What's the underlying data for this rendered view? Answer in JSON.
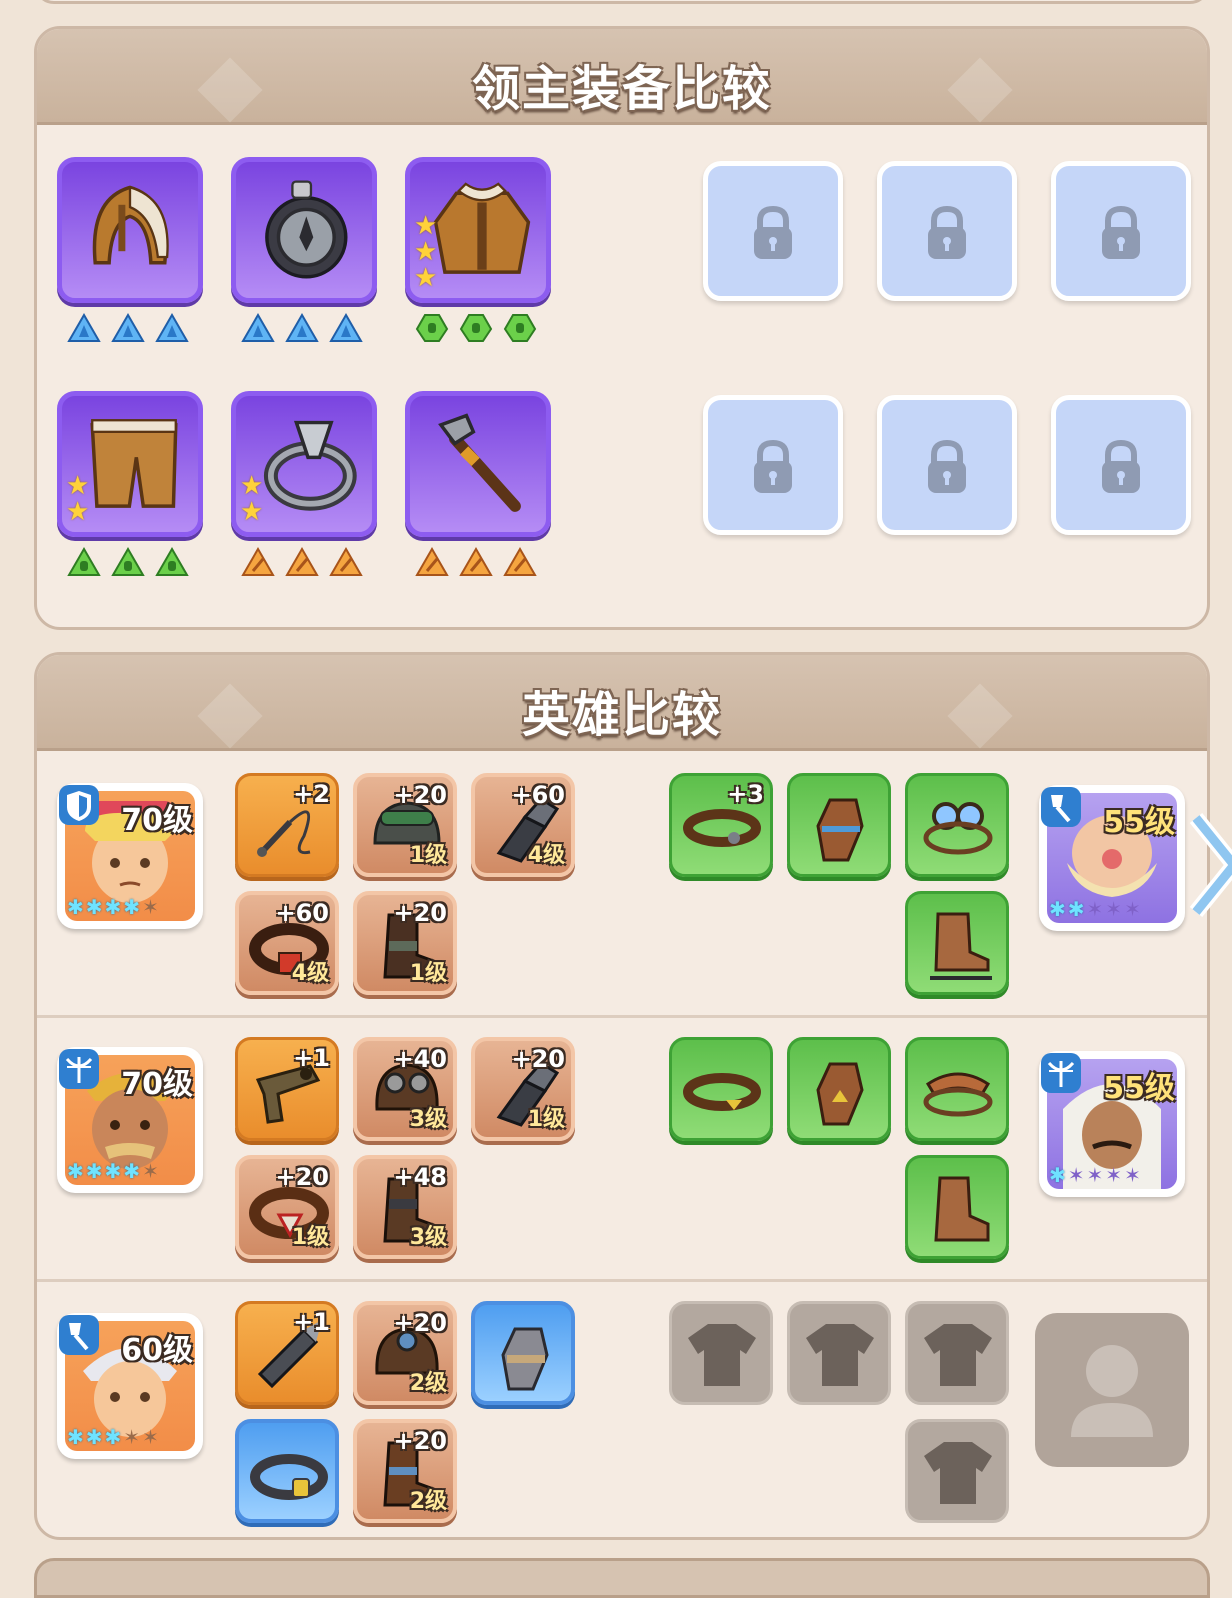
{
  "lord_section": {
    "title": "领主装备比较",
    "items": [
      {
        "name": "fur-hat-icon",
        "gems": "blue",
        "stars": 0
      },
      {
        "name": "compass-wheel-icon",
        "gems": "blue",
        "stars": 0
      },
      {
        "name": "fur-coat-icon",
        "gems": "green",
        "stars": 3
      },
      {
        "name": "fur-pants-icon",
        "gems": "green",
        "stars": 2
      },
      {
        "name": "ring-icon",
        "gems": "orange",
        "stars": 2
      },
      {
        "name": "hammer-staff-icon",
        "gems": "orange",
        "stars": 0
      }
    ],
    "locked_slots": 6
  },
  "hero_section": {
    "title": "英雄比较",
    "rows": [
      {
        "left": {
          "level": "70级",
          "class_icon": "shield-icon",
          "stars_on": 4,
          "stars_total": 5
        },
        "left_equip": [
          {
            "plus": "+2",
            "level": "",
            "tier": "gold",
            "icon": "whip-icon"
          },
          {
            "plus": "+20",
            "level": "1级",
            "tier": "bronze",
            "icon": "goggles-helmet-icon"
          },
          {
            "plus": "+60",
            "level": "4级",
            "tier": "bronze",
            "icon": "gauntlet-icon"
          },
          {
            "plus": "+60",
            "level": "4级",
            "tier": "bronze",
            "icon": "belt-icon"
          },
          {
            "plus": "+20",
            "level": "1级",
            "tier": "bronze",
            "icon": "boot-icon"
          }
        ],
        "right_equip": [
          {
            "plus": "+3",
            "tier": "green",
            "icon": "belt-icon"
          },
          {
            "plus": "",
            "tier": "green",
            "icon": "glove-icon"
          },
          {
            "plus": "",
            "tier": "green",
            "icon": "goggles-icon"
          },
          {
            "plus": "",
            "tier": "green",
            "icon": "skate-boot-icon"
          }
        ],
        "right": {
          "level": "55级",
          "class_icon": "shovel-icon",
          "stars_on": 2,
          "stars_total": 5
        }
      },
      {
        "left": {
          "level": "70级",
          "class_icon": "crossbow-icon",
          "stars_on": 4,
          "stars_total": 5
        },
        "left_equip": [
          {
            "plus": "+1",
            "level": "",
            "tier": "gold",
            "icon": "blaster-icon"
          },
          {
            "plus": "+40",
            "level": "3级",
            "tier": "bronze",
            "icon": "aviator-helmet-icon"
          },
          {
            "plus": "+20",
            "level": "1级",
            "tier": "bronze",
            "icon": "gauntlet-icon"
          },
          {
            "plus": "+20",
            "level": "1级",
            "tier": "bronze",
            "icon": "belt-icon"
          },
          {
            "plus": "+48",
            "level": "3级",
            "tier": "bronze",
            "icon": "boot-icon"
          }
        ],
        "right_equip": [
          {
            "plus": "",
            "tier": "green",
            "icon": "belt-icon"
          },
          {
            "plus": "",
            "tier": "green",
            "icon": "glove-icon"
          },
          {
            "plus": "",
            "tier": "green",
            "icon": "goggles-icon"
          },
          {
            "plus": "",
            "tier": "green",
            "icon": "boot-icon"
          }
        ],
        "right": {
          "level": "55级",
          "class_icon": "crossbow-icon",
          "stars_on": 1,
          "stars_total": 5
        }
      },
      {
        "left": {
          "level": "60级",
          "class_icon": "shovel-icon",
          "stars_on": 3,
          "stars_total": 5
        },
        "left_equip": [
          {
            "plus": "+1",
            "level": "",
            "tier": "gold",
            "icon": "drill-icon"
          },
          {
            "plus": "+20",
            "level": "2级",
            "tier": "bronze",
            "icon": "aviator-helmet-icon"
          },
          {
            "plus": "",
            "level": "",
            "tier": "blue",
            "icon": "glove-icon"
          },
          {
            "plus": "",
            "level": "",
            "tier": "blue",
            "icon": "belt-icon"
          },
          {
            "plus": "+20",
            "level": "2级",
            "tier": "bronze",
            "icon": "boot-icon"
          }
        ],
        "right_equip": [
          {
            "plus": "",
            "tier": "gray",
            "icon": "empty-shirt-icon"
          },
          {
            "plus": "",
            "tier": "gray",
            "icon": "empty-shirt-icon"
          },
          {
            "plus": "",
            "tier": "gray",
            "icon": "empty-shirt-icon"
          },
          {
            "plus": "",
            "tier": "gray",
            "icon": "empty-shirt-icon"
          }
        ],
        "right": null
      }
    ]
  }
}
